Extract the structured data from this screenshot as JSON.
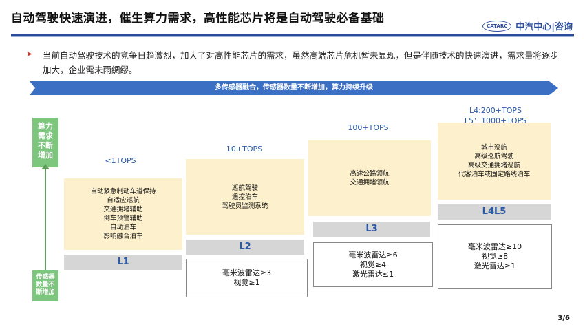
{
  "title": "自动驾驶快速演进，催生算力需求，高性能芯片将是自动驾驶必备基础",
  "logo": {
    "emblem": "CATARC",
    "name": "中汽中心|咨询"
  },
  "bullet": "当前自动驾驶技术的竞争日趋激烈，加大了对高性能芯片的需求，虽然高端芯片危机暂未显现，但是伴随技术的快速演进，需求量将逐步加大，企业需未雨绸缪。",
  "banner": "多传感器融合，传感器数量不断增加，算力持续升级",
  "side": {
    "top": [
      "算力",
      "需求",
      "不断",
      "增加"
    ],
    "bottom": [
      "传感器",
      "数量不",
      "断增加"
    ]
  },
  "levels": [
    {
      "name": "L1",
      "tops": [
        "<1TOPS"
      ],
      "features": [
        "自动紧急制动车道保持",
        "自适应巡航",
        "交通拥堵辅助",
        "倒车预警辅助",
        "自动泊车",
        "影响融合泊车"
      ],
      "sensors": []
    },
    {
      "name": "L2",
      "tops": [
        "10+TOPS"
      ],
      "features": [
        "巡航驾驶",
        "遥控泊车",
        "驾驶员监测系统"
      ],
      "sensors": [
        "毫米波雷达≥3",
        "视觉≥1"
      ]
    },
    {
      "name": "L3",
      "tops": [
        "100+TOPS"
      ],
      "features": [
        "高速公路领航",
        "交通拥堵领航"
      ],
      "sensors": [
        "毫米波雷达≥6",
        "视觉≥4",
        "激光雷达≤1"
      ]
    },
    {
      "name": "L4L5",
      "tops": [
        "L4:200+TOPS",
        "L5：1000+TOPS"
      ],
      "features": [
        "城市巡航",
        "高级巡航驾驶",
        "高级交通拥堵巡航",
        "代客泊车或固定路线泊车"
      ],
      "sensors": [
        "毫米波雷达≥10",
        "视觉≥8",
        "激光雷达≥1"
      ]
    }
  ],
  "page": "3/6",
  "colors": {
    "brand": "#2a4c9a",
    "banner": "#3a6fc4",
    "green": "#7dc67e",
    "feature": "#fdf0cc",
    "bar": "#d6d6d6"
  }
}
